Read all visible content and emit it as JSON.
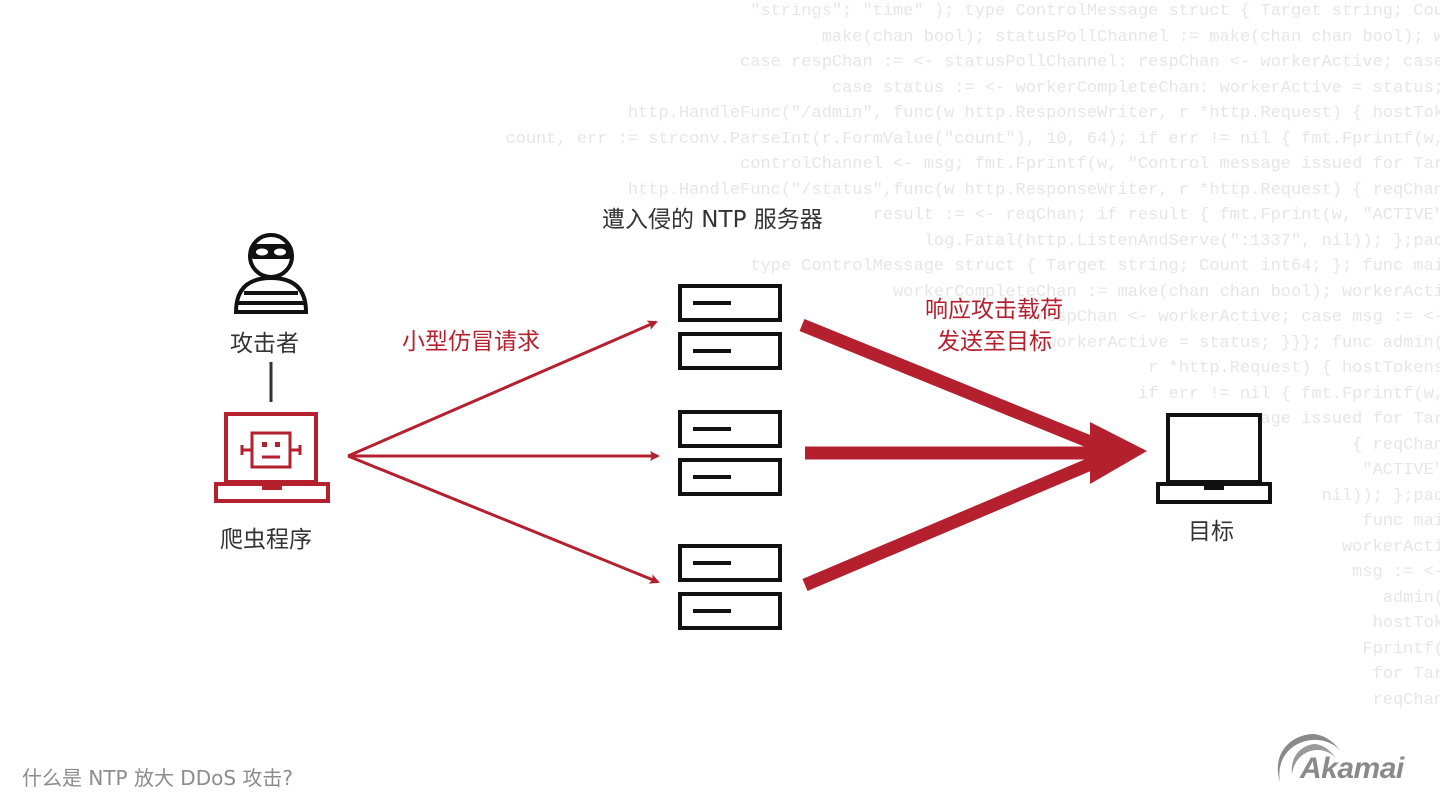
{
  "diagram": {
    "title": "什么是 NTP 放大 DDoS 攻击?",
    "nodes": {
      "attacker": {
        "label": "攻击者",
        "icon": "masked-person-icon"
      },
      "bot": {
        "label": "爬虫程序",
        "icon": "robot-laptop-icon"
      },
      "servers": {
        "label": "遭入侵的 NTP 服务器",
        "icon": "server-icon",
        "count": 3
      },
      "target": {
        "label": "目标",
        "icon": "laptop-icon"
      }
    },
    "edges": {
      "requests": {
        "label": "小型仿冒请求",
        "from": "bot",
        "to": "servers"
      },
      "responses": {
        "label_line1": "响应攻击载荷",
        "label_line2": "发送至目标",
        "from": "servers",
        "to": "target"
      }
    }
  },
  "brand": {
    "name": "Akamai"
  },
  "colors": {
    "accent": "#b5202e",
    "dark": "#1a1a1a",
    "muted": "#8c8c8c"
  },
  "code_background": [
    "\"strings\"; \"time\" ); type ControlMessage struct { Target string; Cou",
    "make(chan bool); statusPollChannel := make(chan chan bool); w",
    "case respChan := <- statusPollChannel: respChan <- workerActive; case",
    "case status := <- workerCompleteChan: workerActive = status;",
    "http.HandleFunc(\"/admin\", func(w http.ResponseWriter, r *http.Request) { hostTok",
    "count, err := strconv.ParseInt(r.FormValue(\"count\"), 10, 64); if err != nil { fmt.Fprintf(w,",
    "controlChannel <- msg; fmt.Fprintf(w, \"Control message issued for Tar",
    "http.HandleFunc(\"/status\",func(w http.ResponseWriter, r *http.Request) { reqChan",
    "result := <- reqChan; if result { fmt.Fprint(w, \"ACTIVE\"",
    "log.Fatal(http.ListenAndServe(\":1337\", nil)); };pac",
    "type ControlMessage struct { Target string; Count int64; }; func mai",
    "workerCompleteChan := make(chan chan bool); workerActi",
    "respChan <- workerActive; case msg := <-",
    "workerActive = status; }}}; func admin(",
    "r *http.Request) { hostTokens",
    "if err != nil { fmt.Fprintf(w,",
    "message issued for Tar",
    "{ reqChan",
    "\"ACTIVE\"",
    "nil)); };pac",
    "func mai",
    "workerActi",
    "msg := <-",
    "admin(",
    "hostTok",
    "Fprintf(",
    "for Tar",
    "reqChan"
  ]
}
